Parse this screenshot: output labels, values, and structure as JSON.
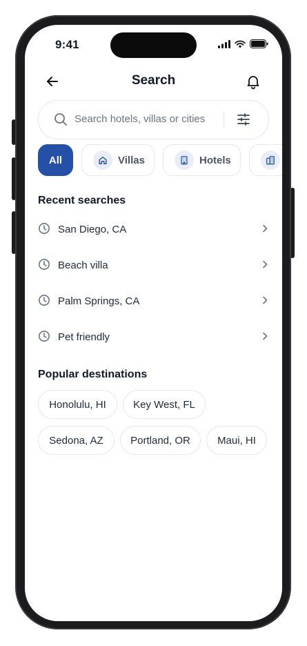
{
  "status": {
    "time": "9:41"
  },
  "header": {
    "title": "Search"
  },
  "search": {
    "placeholder": "Search hotels, villas or cities"
  },
  "chips": [
    {
      "label": "All",
      "active": true
    },
    {
      "label": "Villas",
      "icon": "home-icon"
    },
    {
      "label": "Hotels",
      "icon": "building-icon"
    },
    {
      "label": "",
      "icon": "apartments-icon"
    }
  ],
  "recent": {
    "title": "Recent searches",
    "items": [
      {
        "label": "San Diego, CA"
      },
      {
        "label": "Beach villa"
      },
      {
        "label": "Palm Springs, CA"
      },
      {
        "label": "Pet friendly"
      }
    ]
  },
  "popular": {
    "title": "Popular destinations",
    "items": [
      {
        "label": "Honolulu, HI"
      },
      {
        "label": "Key West, FL"
      },
      {
        "label": "Sedona, AZ"
      },
      {
        "label": "Portland, OR"
      },
      {
        "label": "Maui, HI"
      }
    ]
  },
  "colors": {
    "accent": "#2450a8",
    "chip_icon_bg": "#e8edf7",
    "border": "#e5e7eb"
  }
}
